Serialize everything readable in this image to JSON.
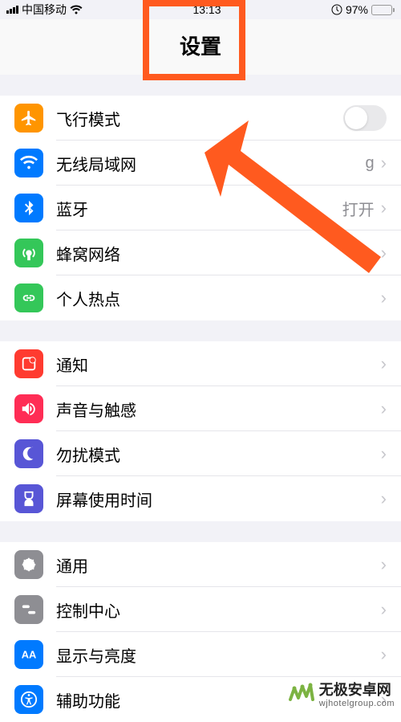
{
  "status": {
    "carrier": "中国移动",
    "time": "13:13",
    "battery_pct": "97%"
  },
  "header": {
    "title": "设置"
  },
  "group1": {
    "airplane": {
      "label": "飞行模式",
      "icon_bg": "#ff9500"
    },
    "wifi": {
      "label": "无线局域网",
      "value": "g",
      "icon_bg": "#007aff"
    },
    "bluetooth": {
      "label": "蓝牙",
      "value": "打开",
      "icon_bg": "#007aff"
    },
    "cellular": {
      "label": "蜂窝网络",
      "icon_bg": "#34c759"
    },
    "hotspot": {
      "label": "个人热点",
      "icon_bg": "#34c759"
    }
  },
  "group2": {
    "notifications": {
      "label": "通知",
      "icon_bg": "#ff3b30"
    },
    "sounds": {
      "label": "声音与触感",
      "icon_bg": "#ff2d55"
    },
    "dnd": {
      "label": "勿扰模式",
      "icon_bg": "#5856d6"
    },
    "screentime": {
      "label": "屏幕使用时间",
      "icon_bg": "#5856d6"
    }
  },
  "group3": {
    "general": {
      "label": "通用",
      "icon_bg": "#8e8e93"
    },
    "control": {
      "label": "控制中心",
      "icon_bg": "#8e8e93"
    },
    "display": {
      "label": "显示与亮度",
      "icon_bg": "#007aff"
    },
    "accessibility": {
      "label": "辅助功能",
      "icon_bg": "#007aff"
    }
  },
  "watermark": {
    "main": "无极安卓网",
    "sub": "wjhotelgroup.com"
  },
  "colors": {
    "highlight": "#ff5a1f"
  }
}
